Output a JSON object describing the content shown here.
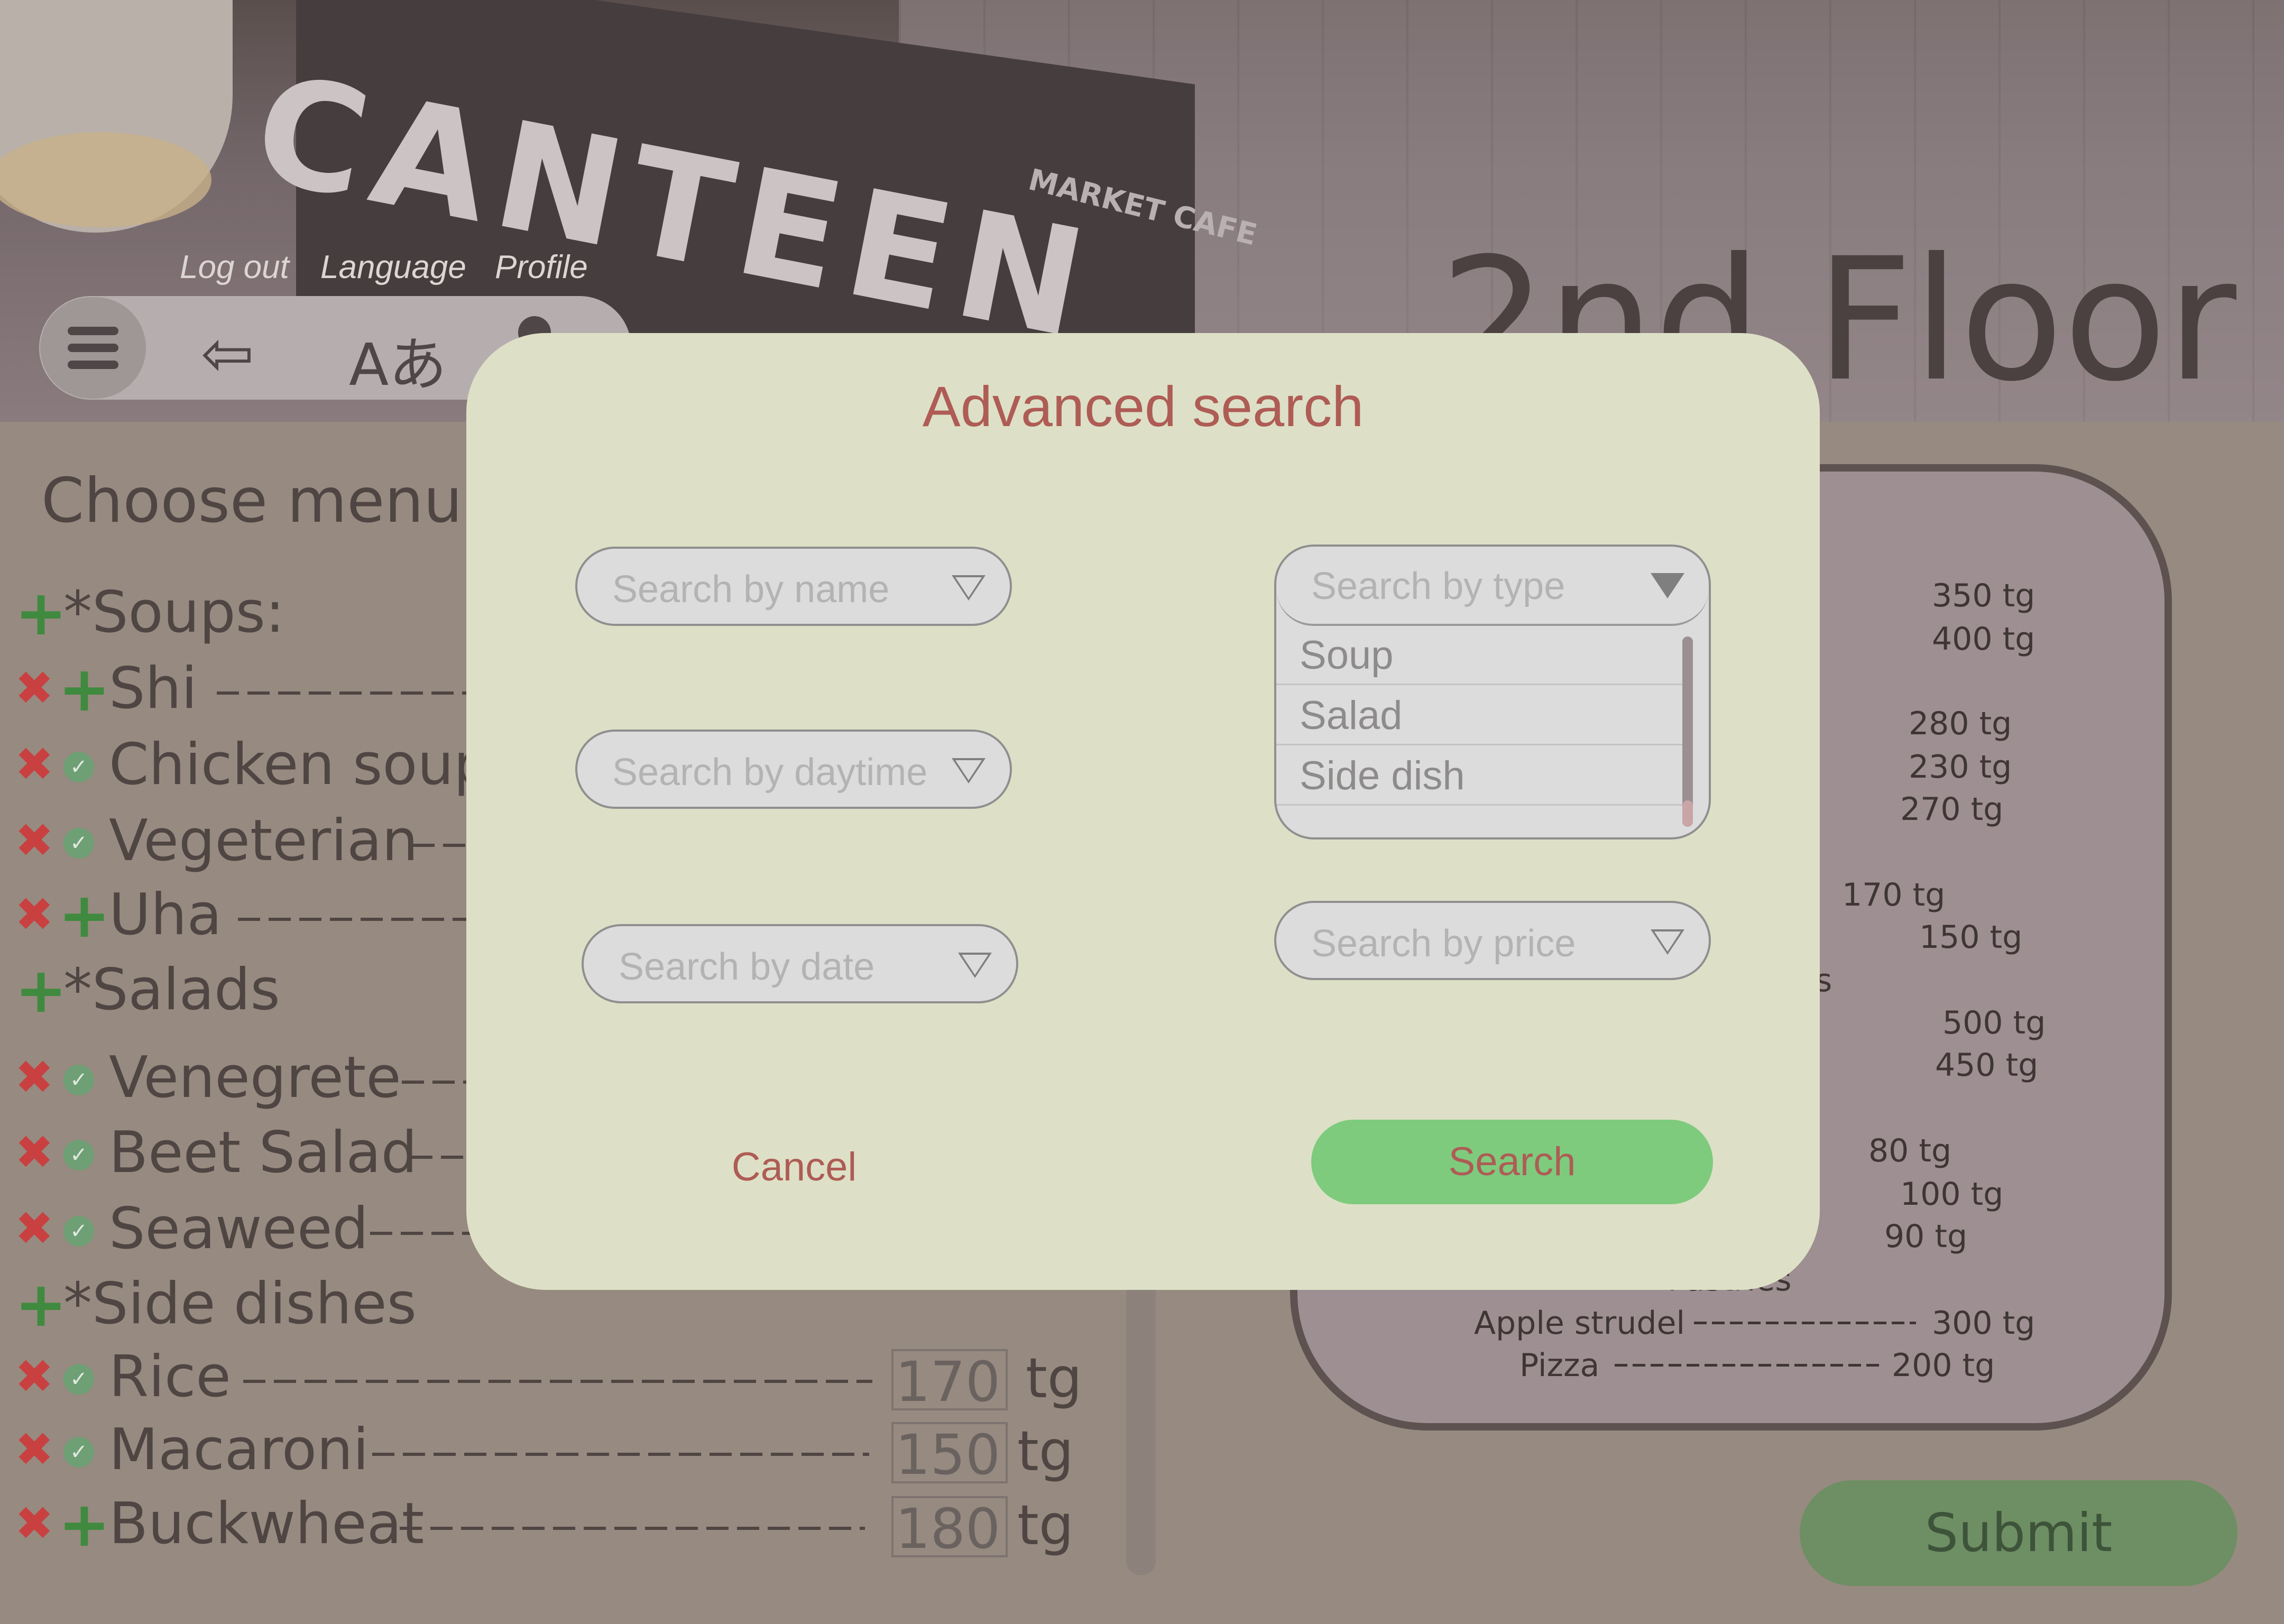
{
  "header": {
    "canteen_sign": "CANTEEN",
    "market_sign": "MARKET CAFE",
    "floor_title": "2nd Floor",
    "nav_labels": {
      "logout": "Log out",
      "language": "Language",
      "profile": "Profile"
    },
    "lang_glyph": "Aあ"
  },
  "menu": {
    "heading": "Choose menu f",
    "categories": [
      {
        "label": "*Soups:"
      },
      {
        "label": "*Salads"
      },
      {
        "label": "*Side dishes"
      }
    ],
    "items": [
      {
        "name": "Shi",
        "state": "plus"
      },
      {
        "name": "Chicken soup",
        "state": "checked"
      },
      {
        "name": "Vegeterian",
        "state": "checked"
      },
      {
        "name": "Uha",
        "state": "plus"
      },
      {
        "name": "Venegrete",
        "state": "checked"
      },
      {
        "name": "Beet Salad",
        "state": "checked"
      },
      {
        "name": "Seaweed",
        "state": "checked"
      },
      {
        "name": "Rice",
        "state": "checked",
        "price": "170",
        "unit": "tg"
      },
      {
        "name": "Macaroni",
        "state": "checked",
        "price": "150",
        "unit": "tg"
      },
      {
        "name": "Buckwheat",
        "state": "plus",
        "price": "180",
        "unit": "tg"
      }
    ]
  },
  "summary": {
    "lines": [
      "350 tg",
      "400 tg",
      "280 tg",
      "230 tg",
      "270 tg",
      "170 tg",
      "150 tg",
      "s",
      "500 tg",
      "450 tg",
      "80 tg",
      "100 tg",
      "90 tg"
    ],
    "pastries_label": "Pastries",
    "pastries": [
      {
        "name": "Apple strudel",
        "price": "300 tg"
      },
      {
        "name": "Pizza",
        "price": "200 tg"
      }
    ],
    "submit_label": "Submit"
  },
  "modal": {
    "title": "Advanced search",
    "name_placeholder": "Search by name",
    "daytime_placeholder": "Search by daytime",
    "date_placeholder": "Search by date",
    "type_placeholder": "Search by type",
    "price_placeholder": "Search by price",
    "type_options": [
      "Soup",
      "Salad",
      "Side dish"
    ],
    "cancel_label": "Cancel",
    "search_label": "Search"
  },
  "colors": {
    "accent_red": "#ae5c55",
    "search_green": "#7ecb7e",
    "modal_bg": "#dde0c6",
    "delete_red": "#c94040",
    "add_green": "#3f8a3f"
  }
}
